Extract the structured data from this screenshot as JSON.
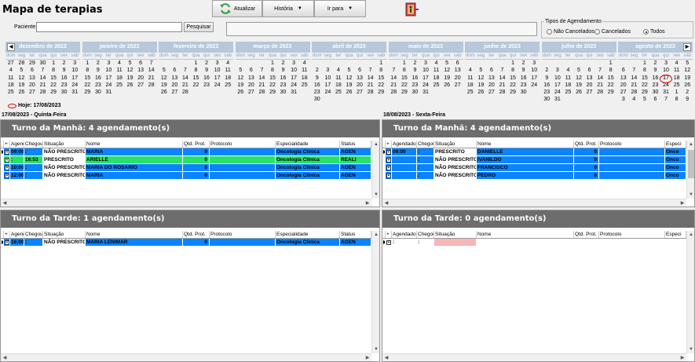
{
  "app_title": "Mapa de terapias",
  "toolbar": {
    "refresh": "Atualizar",
    "history": "História",
    "goto": "Ir para"
  },
  "search": {
    "label": "Paciente:",
    "value": "",
    "button": "Pesquisar"
  },
  "tipos": {
    "label": "Tipos de Agendamento",
    "options": [
      "Não Cancelados",
      "Cancelados",
      "Todos"
    ],
    "selected": "Todos"
  },
  "calendar": {
    "dow": [
      "dom",
      "seg",
      "ter",
      "qua",
      "qui",
      "sex",
      "sáb"
    ],
    "months": [
      {
        "name": "dezembro de 2022",
        "days": [
          27,
          28,
          29,
          30,
          1,
          2,
          3,
          4,
          5,
          6,
          7,
          8,
          9,
          10,
          11,
          12,
          13,
          14,
          15,
          16,
          17,
          18,
          19,
          20,
          21,
          22,
          23,
          24,
          25,
          26,
          27,
          28,
          29,
          30,
          31
        ]
      },
      {
        "name": "janeiro de 2023",
        "days": [
          1,
          2,
          3,
          4,
          5,
          6,
          7,
          8,
          9,
          10,
          11,
          12,
          13,
          14,
          15,
          16,
          17,
          18,
          19,
          20,
          21,
          22,
          23,
          24,
          25,
          26,
          27,
          28,
          29,
          30,
          31
        ]
      },
      {
        "name": "fevereiro de 2023",
        "days": [
          "",
          "",
          "",
          1,
          2,
          3,
          4,
          5,
          6,
          7,
          8,
          9,
          10,
          11,
          12,
          13,
          14,
          15,
          16,
          17,
          18,
          19,
          20,
          21,
          22,
          23,
          24,
          25,
          26,
          27,
          28
        ]
      },
      {
        "name": "março de 2023",
        "days": [
          "",
          "",
          "",
          1,
          2,
          3,
          4,
          5,
          6,
          7,
          8,
          9,
          10,
          11,
          12,
          13,
          14,
          15,
          16,
          17,
          18,
          19,
          20,
          21,
          22,
          23,
          24,
          25,
          26,
          27,
          28,
          29,
          30,
          31
        ]
      },
      {
        "name": "abril de 2023",
        "days": [
          "",
          "",
          "",
          "",
          "",
          "",
          1,
          2,
          3,
          4,
          5,
          6,
          7,
          8,
          9,
          10,
          11,
          12,
          13,
          14,
          15,
          16,
          17,
          18,
          19,
          20,
          21,
          22,
          23,
          24,
          25,
          26,
          27,
          28,
          29,
          30
        ]
      },
      {
        "name": "maio de 2023",
        "days": [
          "",
          1,
          2,
          3,
          4,
          5,
          6,
          7,
          8,
          9,
          10,
          11,
          12,
          13,
          14,
          15,
          16,
          17,
          18,
          19,
          20,
          21,
          22,
          23,
          24,
          25,
          26,
          27,
          28,
          29,
          30,
          31
        ]
      },
      {
        "name": "junho de 2023",
        "days": [
          "",
          "",
          "",
          "",
          1,
          2,
          3,
          4,
          5,
          6,
          7,
          8,
          9,
          10,
          11,
          12,
          13,
          14,
          15,
          16,
          17,
          18,
          19,
          20,
          21,
          22,
          23,
          24,
          25,
          26,
          27,
          28,
          29,
          30
        ]
      },
      {
        "name": "julho de 2023",
        "days": [
          "",
          "",
          "",
          "",
          "",
          "",
          1,
          2,
          3,
          4,
          5,
          6,
          7,
          8,
          9,
          10,
          11,
          12,
          13,
          14,
          15,
          16,
          17,
          18,
          19,
          20,
          21,
          22,
          23,
          24,
          25,
          26,
          27,
          28,
          29,
          30,
          31
        ]
      },
      {
        "name": "agosto de 2023",
        "days": [
          "",
          "",
          1,
          2,
          3,
          4,
          5,
          6,
          7,
          8,
          9,
          10,
          11,
          12,
          13,
          14,
          15,
          16,
          17,
          18,
          19,
          20,
          21,
          22,
          23,
          24,
          25,
          26,
          27,
          28,
          29,
          30,
          31,
          1,
          2,
          3,
          4,
          5,
          6,
          7,
          8,
          9
        ],
        "today": 17
      }
    ],
    "today_label": "Hoje: 17/08/2023"
  },
  "left": {
    "date_label": "17/08/2023 - Quinta-Feira",
    "morning": {
      "title": "Turno da Manhã: 4 agendamento(s)",
      "rows": [
        {
          "agendado": "09:00",
          "chegou": ":",
          "situacao": "NÃO PRESCRITO",
          "nome": "MARIA",
          "qtd": "0",
          "protocolo": "",
          "especialidade": "Oncologia Clinica",
          "status": "AGEN",
          "color": "#0a84ff",
          "pointer": true
        },
        {
          "agendado": ":",
          "chegou": "16:53",
          "situacao": "PRESCRITO",
          "nome": "ARIELLE",
          "qtd": "0",
          "protocolo": "",
          "especialidade": "Oncologia Clinica",
          "status": "REALI",
          "color": "#27e16b",
          "pointer": false
        },
        {
          "agendado": "10:00",
          "chegou": ":",
          "situacao": "NÃO PRESCRITO",
          "nome": "MARIA DO ROSARIO",
          "qtd": "0",
          "protocolo": "",
          "especialidade": "Oncologia Clinica",
          "status": "AGEN",
          "color": "#0a84ff",
          "pointer": false
        },
        {
          "agendado": "12:00",
          "chegou": ":",
          "situacao": "NÃO PRESCRITO",
          "nome": "MARIA",
          "qtd": "0",
          "protocolo": "",
          "especialidade": "Oncologia Clinica",
          "status": "AGEN",
          "color": "#0a84ff",
          "pointer": false
        }
      ]
    },
    "afternoon": {
      "title": "Turno da Tarde: 1 agendamento(s)",
      "rows": [
        {
          "agendado": "16:00",
          "chegou": ":",
          "situacao": "NÃO PRESCRITO",
          "nome": "MARIA LENIMAR",
          "qtd": "0",
          "protocolo": "",
          "especialidade": "Oncologia Clinica",
          "status": "AGEN",
          "color": "#0a84ff",
          "pointer": true
        }
      ]
    }
  },
  "right": {
    "date_label": "18/08/2023 - Sexta-Feira",
    "morning": {
      "title": "Turno da Manhã: 4 agendamento(s)",
      "rows": [
        {
          "agendado": "09:00",
          "chegou": ":",
          "situacao": "PRESCRITO",
          "nome": "DANIELLE",
          "qtd": "0",
          "protocolo": "",
          "especialidade": "Onco",
          "color": "#0a84ff",
          "pointer": true
        },
        {
          "agendado": "",
          "chegou": ":",
          "situacao": "NÃO PRESCRITO",
          "nome": "IVANILDO",
          "qtd": "0",
          "protocolo": "",
          "especialidade": "Onco",
          "color": "#0a84ff",
          "pointer": false
        },
        {
          "agendado": "",
          "chegou": ":",
          "situacao": "NÃO PRESCRITO",
          "nome": "FRANCISCO",
          "qtd": "0",
          "protocolo": "",
          "especialidade": "Onco",
          "color": "#0a84ff",
          "pointer": false
        },
        {
          "agendado": "",
          "chegou": ":",
          "situacao": "NÃO PRESCRITO",
          "nome": "PEDRO",
          "qtd": "0",
          "protocolo": "",
          "especialidade": "Onco",
          "color": "#0a84ff",
          "pointer": false
        }
      ]
    },
    "afternoon": {
      "title": "Turno da Tarde: 0 agendamento(s)",
      "rows": [
        {
          "agendado": ":",
          "chegou": ":",
          "situacao": "",
          "nome": "",
          "qtd": "",
          "protocolo": "",
          "especialidade": "",
          "color": "#ffffff",
          "pointer": true
        }
      ]
    }
  },
  "columns_left": [
    "+",
    "Agendado",
    "Chegou",
    "Situação",
    "Nome",
    "Qtd. Prot.",
    "Protocolo",
    "Especialidade",
    "Status"
  ],
  "columns_right": [
    "+",
    "Agendado",
    "Chegou",
    "Situação",
    "Nome",
    "Qtd. Prot.",
    "Protocolo",
    "Especi"
  ]
}
